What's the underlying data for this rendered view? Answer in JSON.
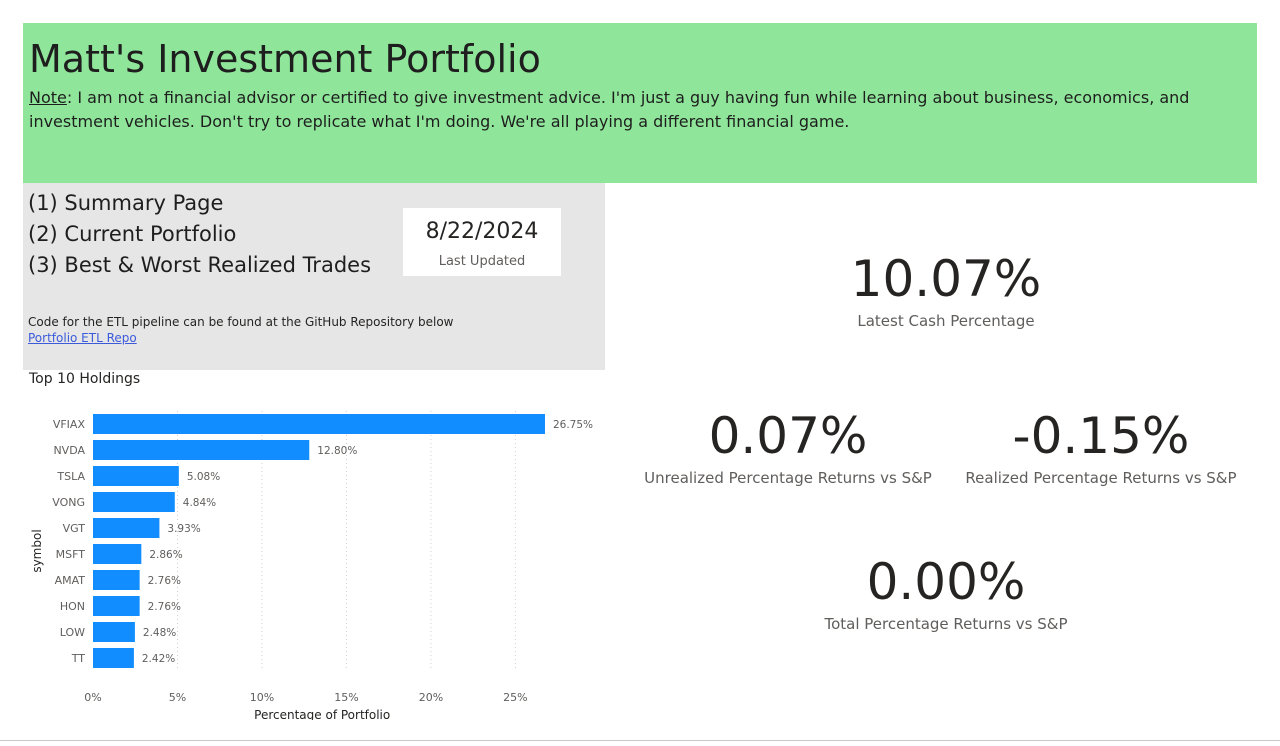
{
  "header": {
    "title": "Matt's Investment Portfolio",
    "note_label": "Note",
    "note_text": ": I am not a financial advisor or certified to give investment advice. I'm just a guy having fun while learning about business, economics, and investment vehicles. Don't try to replicate what I'm doing. We're all playing a different financial game.",
    "background_color": "#8fe69a"
  },
  "nav": {
    "items": [
      {
        "label": "(1) Summary Page"
      },
      {
        "label": "(2) Current Portfolio"
      },
      {
        "label": "(3) Best & Worst Realized Trades"
      }
    ],
    "etl_text": "Code for the ETL pipeline can be found at the GitHub Repository below",
    "etl_link": "Portfolio ETL Repo"
  },
  "last_updated": {
    "value": "8/22/2024",
    "caption": "Last Updated"
  },
  "kpis": {
    "cash": {
      "value": "10.07%",
      "caption": "Latest Cash Percentage"
    },
    "unrealized": {
      "value": "0.07%",
      "caption": "Unrealized Percentage Returns vs S&P"
    },
    "realized": {
      "value": "-0.15%",
      "caption": "Realized Percentage Returns vs S&P"
    },
    "total": {
      "value": "0.00%",
      "caption": "Total Percentage Returns vs S&P"
    }
  },
  "chart_title": "Top 10 Holdings",
  "chart_data": {
    "type": "bar",
    "orientation": "horizontal",
    "categories": [
      "VFIAX",
      "NVDA",
      "TSLA",
      "VONG",
      "VGT",
      "MSFT",
      "AMAT",
      "HON",
      "LOW",
      "TT"
    ],
    "values": [
      26.75,
      12.8,
      5.08,
      4.84,
      3.93,
      2.86,
      2.76,
      2.76,
      2.48,
      2.42
    ],
    "data_labels": [
      "26.75%",
      "12.80%",
      "5.08%",
      "4.84%",
      "3.93%",
      "2.86%",
      "2.76%",
      "2.76%",
      "2.48%",
      "2.42%"
    ],
    "x_ticks": [
      0,
      5,
      10,
      15,
      20,
      25
    ],
    "x_tick_labels": [
      "0%",
      "5%",
      "10%",
      "15%",
      "20%",
      "25%"
    ],
    "xlabel": "Percentage of Portfolio",
    "ylabel": "symbol",
    "xlim": [
      0,
      29
    ],
    "grid": "vertical-dotted",
    "bar_color": "#118dff"
  }
}
